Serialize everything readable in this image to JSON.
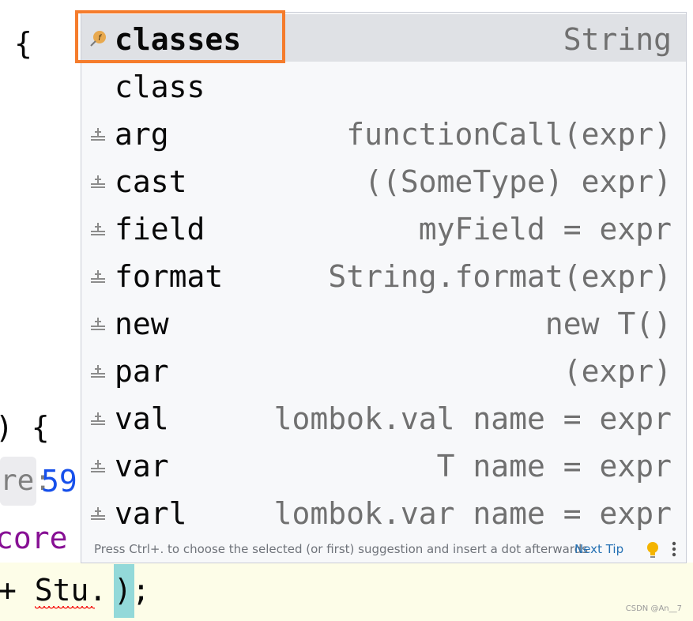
{
  "editor": {
    "line1_brace": "{",
    "line2_fragment": ") {",
    "hint_label": "re:",
    "hint_value": "59",
    "line4_fragment": "core",
    "current_line_prefix": "+ Stu.",
    "current_line_paren": ")",
    "current_line_semicolon": ";",
    "watermark": "CSDN @An__7"
  },
  "colors": {
    "selection_bg": "#dfe1e5",
    "highlight_border": "#f57c2c",
    "link": "#2470b3",
    "keyword_purple": "#871094",
    "number_blue": "#1750eb",
    "bracket_match": "#93d9d9"
  },
  "completion": {
    "items": [
      {
        "name": "classes",
        "tail": "String",
        "icon": "field-icon"
      },
      {
        "name": "class",
        "tail": "",
        "icon": ""
      },
      {
        "name": "arg",
        "tail": "functionCall(expr)",
        "icon": "postfix-template-icon"
      },
      {
        "name": "cast",
        "tail": "((SomeType) expr)",
        "icon": "postfix-template-icon"
      },
      {
        "name": "field",
        "tail": "myField = expr",
        "icon": "postfix-template-icon"
      },
      {
        "name": "format",
        "tail": "String.format(expr)",
        "icon": "postfix-template-icon"
      },
      {
        "name": "new",
        "tail": "new T()",
        "icon": "postfix-template-icon"
      },
      {
        "name": "par",
        "tail": "(expr)",
        "icon": "postfix-template-icon"
      },
      {
        "name": "val",
        "tail": "lombok.val name = expr",
        "icon": "postfix-template-icon"
      },
      {
        "name": "var",
        "tail": "T name = expr",
        "icon": "postfix-template-icon"
      },
      {
        "name": "varl",
        "tail": "lombok.var name = expr",
        "icon": "postfix-template-icon"
      }
    ],
    "status_text": "Press Ctrl+. to choose the selected (or first) suggestion and insert a dot afterwards",
    "next_tip_label": "Next Tip",
    "bulb_icon": "lightbulb-icon",
    "more_icon": "more-vertical-icon"
  }
}
